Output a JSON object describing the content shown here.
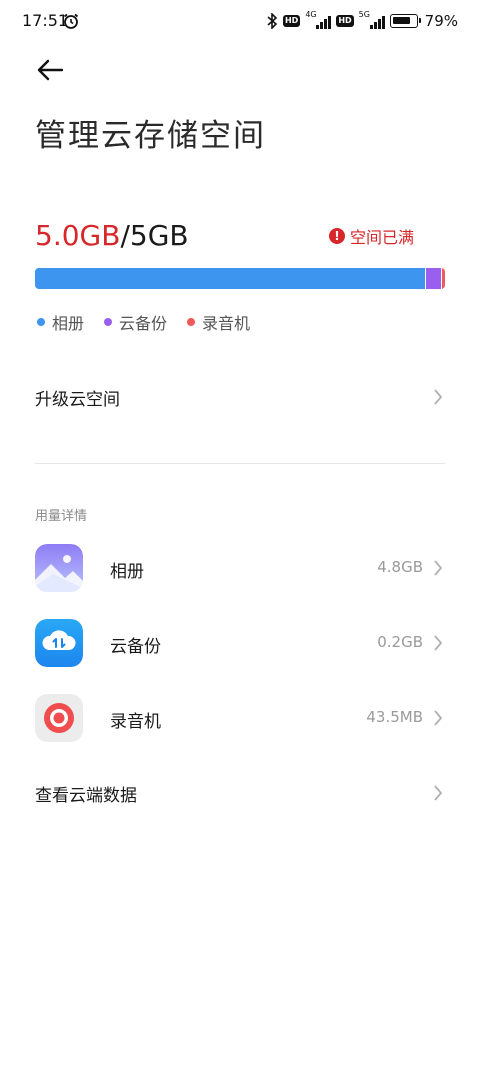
{
  "status_bar": {
    "time": "17:51",
    "network_1": "4G",
    "network_2": "5G",
    "battery_percent": "79%",
    "battery_level": 0.79,
    "icons": [
      "alarm-icon",
      "bluetooth-icon",
      "hd-icon",
      "signal-icon",
      "battery-icon"
    ]
  },
  "header": {
    "back_icon": "arrow-left-icon",
    "title": "管理云存储空间"
  },
  "storage": {
    "used": "5.0GB",
    "separator": "/",
    "total": "5GB",
    "status_text": "空间已满",
    "status_icon": "alert-circle-icon",
    "colors": {
      "album": "#3d95f0",
      "cloud_backup": "#9b5ff0",
      "recorder": "#ee5a5a",
      "alert": "#d8272a"
    },
    "segments": [
      {
        "name": "相册",
        "value_gb": 4.8
      },
      {
        "name": "云备份",
        "value_gb": 0.2
      },
      {
        "name": "录音机",
        "value_gb": 0.0435
      }
    ]
  },
  "legend": [
    "相册",
    "云备份",
    "录音机"
  ],
  "upgrade": {
    "label": "升级云空间"
  },
  "usage_details": {
    "section_label": "用量详情",
    "items": [
      {
        "name": "相册",
        "size": "4.8GB",
        "icon": "gallery-icon"
      },
      {
        "name": "云备份",
        "size": "0.2GB",
        "icon": "cloud-backup-icon"
      },
      {
        "name": "录音机",
        "size": "43.5MB",
        "icon": "recorder-icon"
      }
    ]
  },
  "view_cloud_data": {
    "label": "查看云端数据"
  }
}
